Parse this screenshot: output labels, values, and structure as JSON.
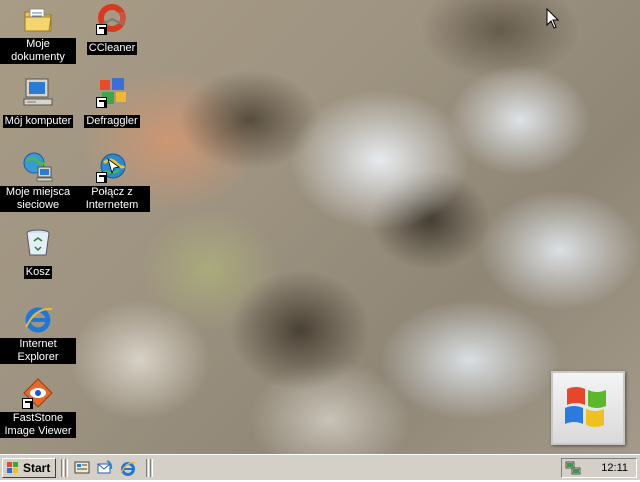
{
  "desktop": {
    "icons": [
      {
        "id": "moje-dokumenty",
        "label": "Moje dokumenty",
        "icon": "folder-documents-icon"
      },
      {
        "id": "ccleaner",
        "label": "CCleaner",
        "icon": "ccleaner-icon",
        "shortcut": true
      },
      {
        "id": "moj-komputer",
        "label": "Mój komputer",
        "icon": "computer-icon"
      },
      {
        "id": "defraggler",
        "label": "Defraggler",
        "icon": "defraggler-icon",
        "shortcut": true
      },
      {
        "id": "moje-miejsca-sieciowe",
        "label": "Moje miejsca sieciowe",
        "icon": "network-places-icon"
      },
      {
        "id": "polacz-z-internetem",
        "label": "Połącz z Internetem",
        "icon": "connect-internet-icon",
        "shortcut": true
      },
      {
        "id": "kosz",
        "label": "Kosz",
        "icon": "recycle-bin-icon"
      },
      {
        "id": "internet-explorer",
        "label": "Internet Explorer",
        "icon": "internet-explorer-icon"
      },
      {
        "id": "faststone",
        "label": "FastStone Image Viewer",
        "icon": "faststone-icon",
        "shortcut": true
      }
    ]
  },
  "taskbar": {
    "start_label": "Start",
    "quick_launch": [
      "show-desktop-icon",
      "outlook-express-icon",
      "internet-explorer-icon"
    ],
    "clock": "12:11",
    "tray_icon": "network-connection-icon"
  },
  "colors": {
    "taskbar": "#d4d0c8",
    "label_bg": "#000000",
    "label_text": "#ffffff"
  }
}
